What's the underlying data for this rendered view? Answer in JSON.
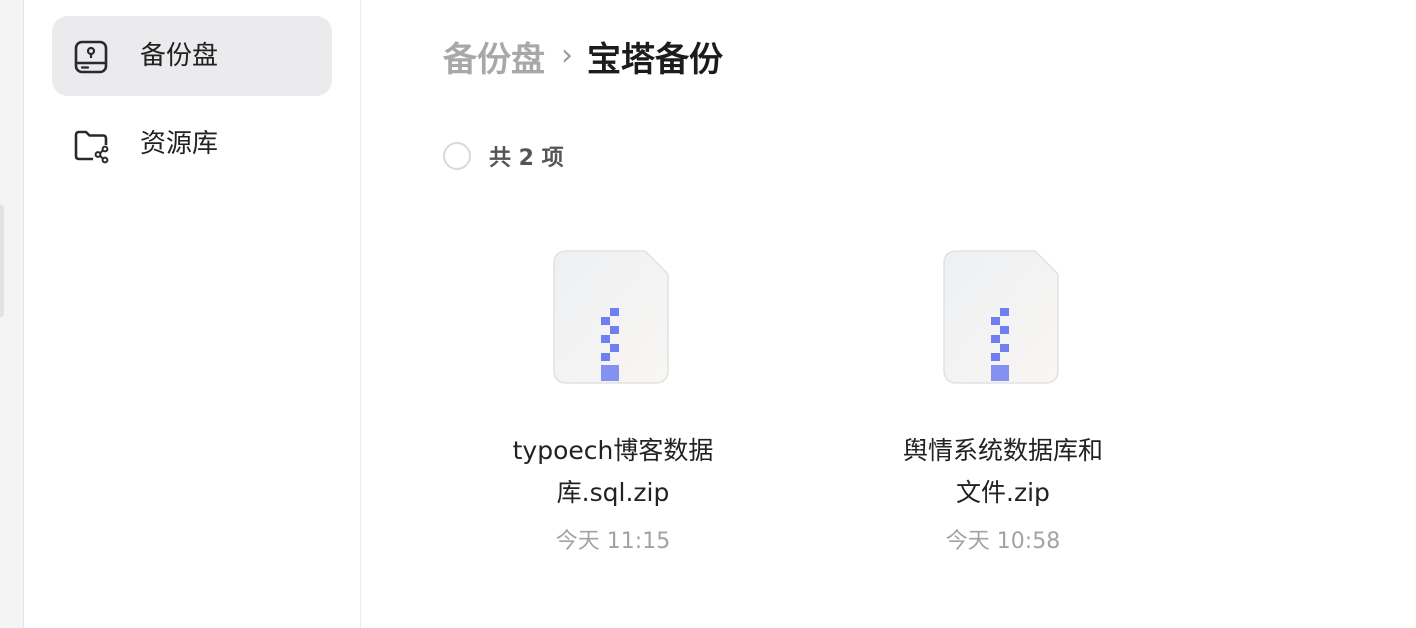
{
  "sidebar": {
    "items": [
      {
        "label": "备份盘",
        "icon": "drive-icon",
        "active": true
      },
      {
        "label": "资源库",
        "icon": "shared-folder-icon",
        "active": false
      }
    ]
  },
  "breadcrumb": {
    "parent": "备份盘",
    "current": "宝塔备份"
  },
  "toolbar": {
    "count_label": "共 2 项"
  },
  "files": [
    {
      "name_line1": "typoech博客数据",
      "name_line2": "库.sql.zip",
      "time": "今天 11:15",
      "icon": "zip-file-icon"
    },
    {
      "name_line1": "舆情系统数据库和",
      "name_line2": "文件.zip",
      "time": "今天 10:58",
      "icon": "zip-file-icon"
    }
  ],
  "colors": {
    "accent": "#6f7ff0",
    "active_bg": "#ebebed",
    "muted_text": "#a8a8aa"
  }
}
